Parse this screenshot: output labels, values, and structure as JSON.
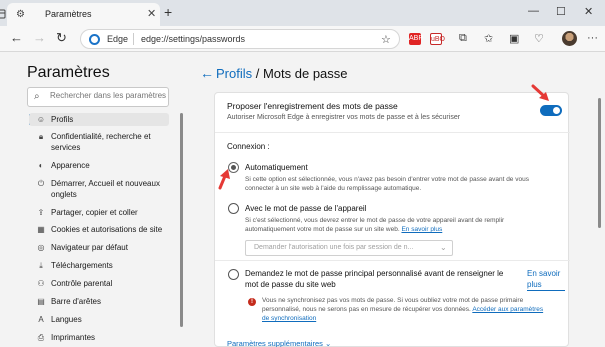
{
  "browser": {
    "tab_title": "Paramètres",
    "address_brand": "Edge",
    "address_url": "edge://settings/passwords",
    "extensions": [
      "ABP",
      "uBO"
    ]
  },
  "sidebar": {
    "title": "Paramètres",
    "search_placeholder": "Rechercher dans les paramètres",
    "items": [
      {
        "label": "Profils",
        "icon": "person-icon",
        "active": true
      },
      {
        "label": "Confidentialité, recherche et services",
        "icon": "lock-icon"
      },
      {
        "label": "Apparence",
        "icon": "appearance-icon"
      },
      {
        "label": "Démarrer, Accueil et nouveaux onglets",
        "icon": "power-icon"
      },
      {
        "label": "Partager, copier et coller",
        "icon": "share-icon"
      },
      {
        "label": "Cookies et autorisations de site",
        "icon": "cookie-icon"
      },
      {
        "label": "Navigateur par défaut",
        "icon": "browser-icon"
      },
      {
        "label": "Téléchargements",
        "icon": "download-icon"
      },
      {
        "label": "Contrôle parental",
        "icon": "family-icon"
      },
      {
        "label": "Barre d'arêtes",
        "icon": "sidebar-icon"
      },
      {
        "label": "Langues",
        "icon": "language-icon"
      },
      {
        "label": "Imprimantes",
        "icon": "printer-icon"
      }
    ]
  },
  "main": {
    "breadcrumb_link": "Profils",
    "breadcrumb_sep": " / ",
    "breadcrumb_current": "Mots de passe",
    "offer_title": "Proposer l'enregistrement des mots de passe",
    "offer_subtitle": "Autoriser Microsoft Edge à enregistrer vos mots de passe et à les sécuriser",
    "offer_enabled": true,
    "connexion_label": "Connexion :",
    "options": [
      {
        "title": "Automatiquement",
        "desc": "Si cette option est sélectionnée, vous n'avez pas besoin d'entrer votre mot de passe avant de vous connecter à un site web à l'aide du remplissage automatique.",
        "checked": true
      },
      {
        "title": "Avec le mot de passe de l'appareil",
        "desc": "Si c'est sélectionné, vous devrez entrer le mot de passe de votre appareil avant de remplir automatiquement votre mot de passe sur un site web.",
        "link": "En savoir plus",
        "checked": false
      },
      {
        "title": "Demandez le mot de passe principal personnalisé avant de renseigner le mot de passe du site web",
        "link": "En savoir plus",
        "checked": false
      }
    ],
    "select_value": "Demander l'autorisation une fois par session de n...",
    "warning_text": "Vous ne synchronisez pas vos mots de passe. Si vous oubliez votre mot de passe primaire personnalisé, nous ne serons pas en mesure de récupérer vos données.",
    "warning_link": "Accéder aux paramètres de synchronisation",
    "more_params": "Paramètres supplémentaires"
  },
  "colors": {
    "accent": "#0f6cbd",
    "annotation": "#e53935",
    "warning": "#c42b1c"
  }
}
